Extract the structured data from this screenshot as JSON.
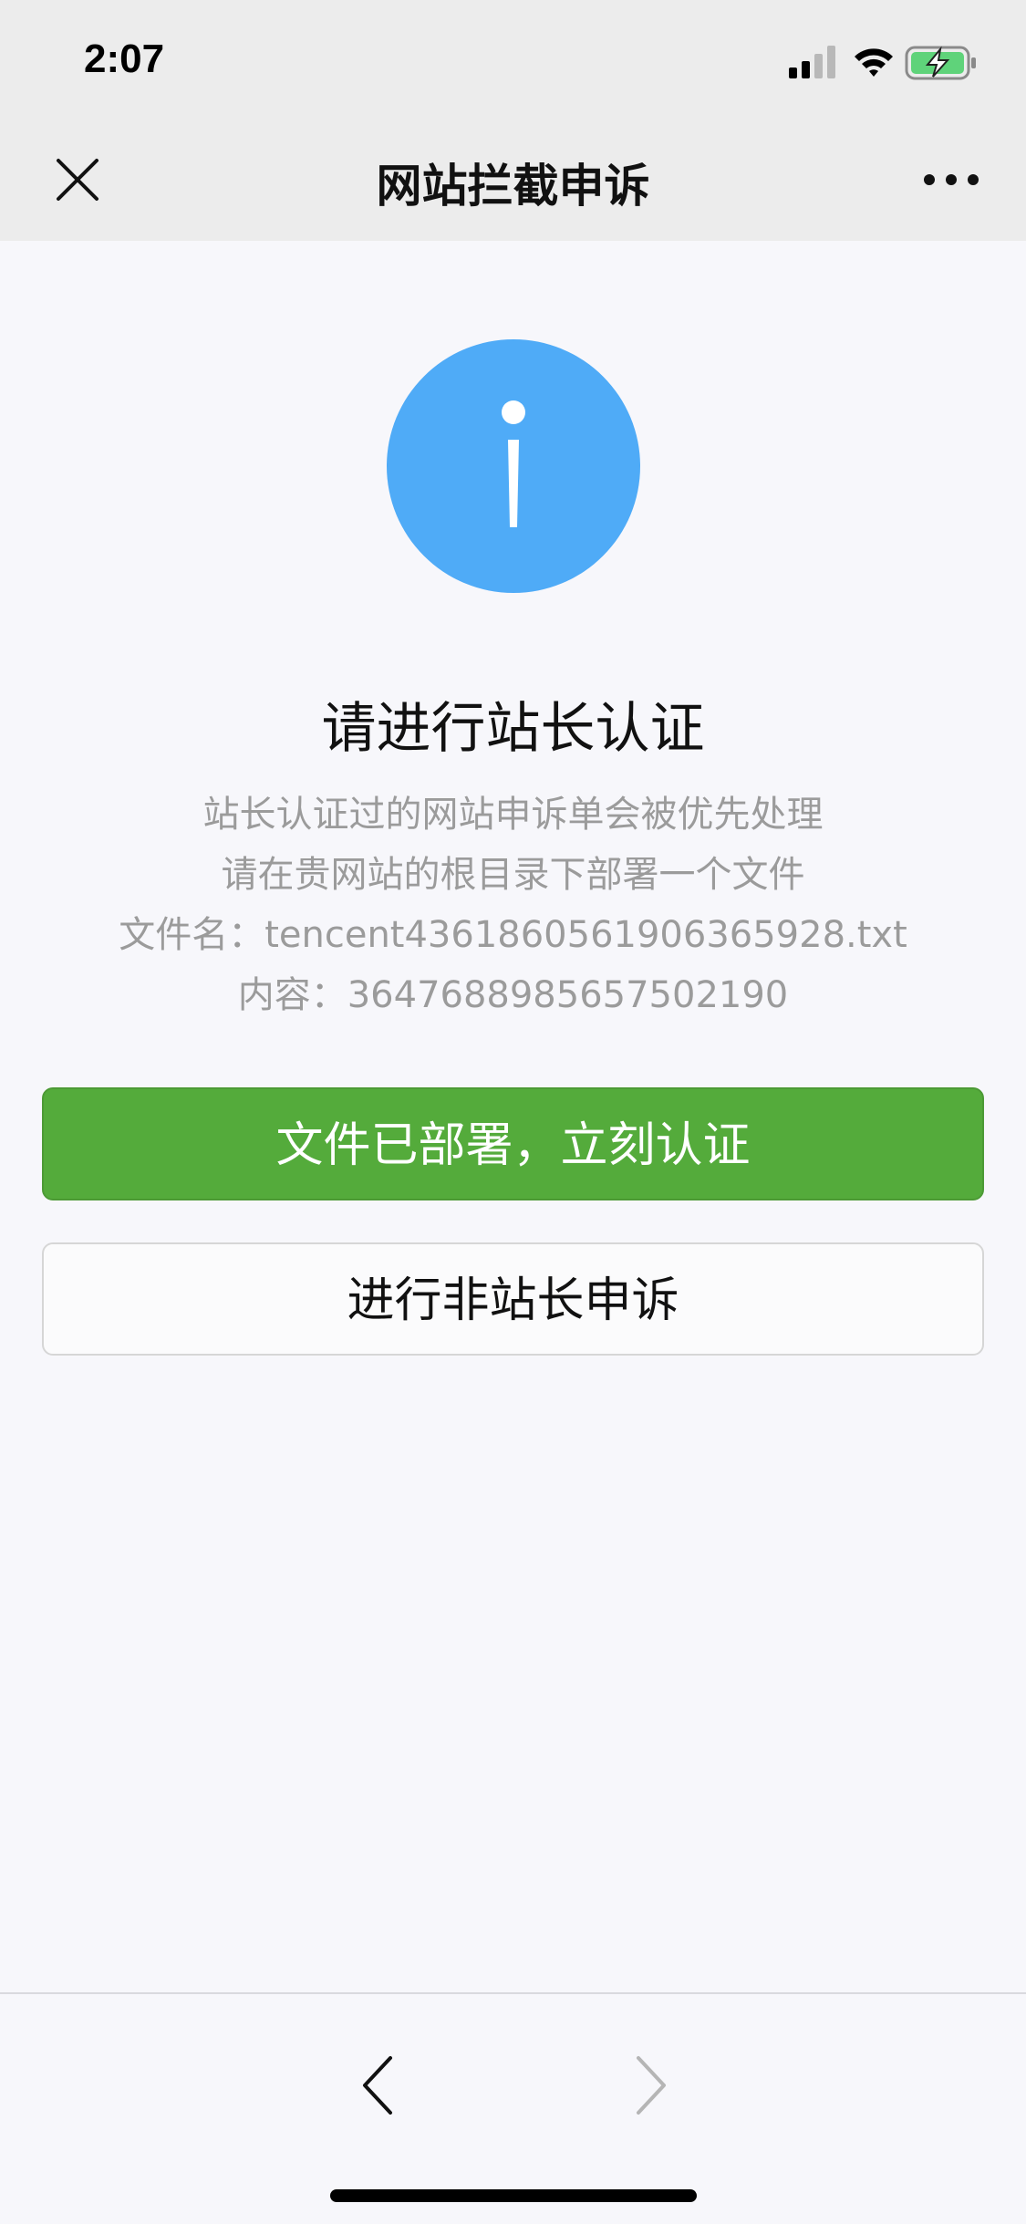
{
  "status_bar": {
    "time": "2:07",
    "icons": [
      "cellular-signal-icon",
      "wifi-icon",
      "battery-charging-icon"
    ]
  },
  "nav": {
    "title": "网站拦截申诉",
    "close_icon": "close-icon",
    "more_icon": "more-icon"
  },
  "main": {
    "icon": "info-icon",
    "icon_color": "#4fabf7",
    "heading": "请进行站长认证",
    "description_lines": [
      "站长认证过的网站申诉单会被优先处理",
      "请在贵网站的根目录下部署一个文件",
      "文件名：tencent4361860561906365928.txt",
      "内容：3647688985657502190"
    ],
    "primary_button": "文件已部署，立刻认证",
    "primary_color": "#54ab3b",
    "secondary_button": "进行非站长申诉"
  },
  "bottom_nav": {
    "back_icon": "chevron-left-icon",
    "forward_icon": "chevron-right-icon"
  }
}
